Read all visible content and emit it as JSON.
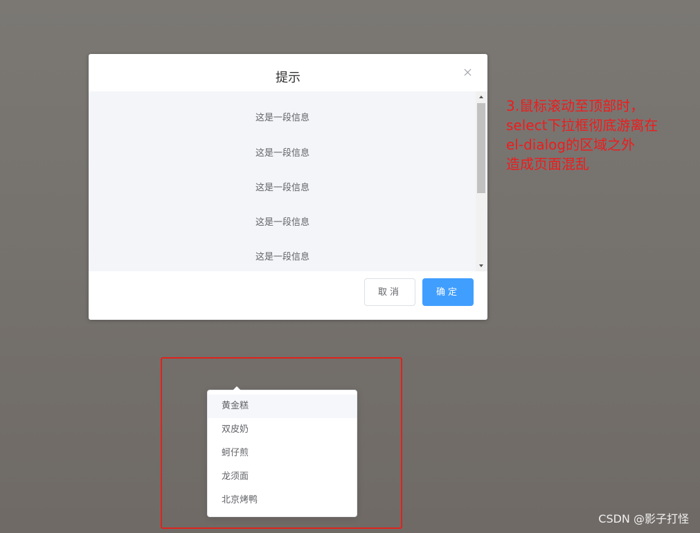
{
  "dialog": {
    "title": "提示",
    "messages": [
      "这是一段信息",
      "这是一段信息",
      "这是一段信息",
      "这是一段信息",
      "这是一段信息"
    ],
    "cancel_label": "取消",
    "confirm_label": "确定"
  },
  "annotation": {
    "lines": [
      "3.鼠标滚动至顶部时，",
      "select下拉框彻底游离在",
      "el-dialog的区域之外",
      "造成页面混乱"
    ],
    "color": "#ee1c1c"
  },
  "dropdown": {
    "options": [
      "黄金糕",
      "双皮奶",
      "蚵仔煎",
      "龙须面",
      "北京烤鸭"
    ],
    "hovered": "黄金糕"
  },
  "watermark": "CSDN @影子打怪",
  "colors": {
    "primary": "#409eff",
    "highlight_box": "#e0221b"
  }
}
